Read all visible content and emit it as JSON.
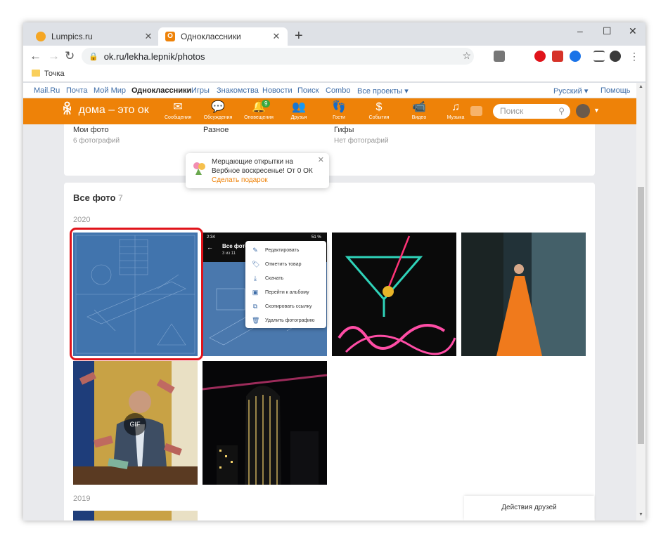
{
  "browser": {
    "tabs": [
      {
        "title": "Lumpics.ru",
        "active": false
      },
      {
        "title": "Одноклассники",
        "active": true
      }
    ],
    "new_tab": "+",
    "controls": {
      "minimize": "–",
      "maximize": "☐",
      "close": "✕"
    },
    "url": "ok.ru/lekha.lepnik/photos",
    "bookmark": "Точка"
  },
  "portal_links": [
    "Mail.Ru",
    "Почта",
    "Мой Мир",
    "Одноклассники",
    "Игры",
    "Знакомства",
    "Новости",
    "Поиск",
    "Combo",
    "Все проекты ▾"
  ],
  "portal_right": {
    "language": "Русский ▾",
    "help": "Помощь"
  },
  "ok_header": {
    "logo_text": "дома – это ок",
    "nav": [
      {
        "label": "Сообщения",
        "icon": "✉"
      },
      {
        "label": "Обсуждения",
        "icon": "💬"
      },
      {
        "label": "Оповещения",
        "icon": "🔔",
        "badge": "9"
      },
      {
        "label": "Друзья",
        "icon": "👥"
      },
      {
        "label": "Гости",
        "icon": "👣"
      },
      {
        "label": "События",
        "icon": "$"
      },
      {
        "label": "Видео",
        "icon": "📹"
      },
      {
        "label": "Музыка",
        "icon": "♫"
      }
    ],
    "search_placeholder": "Поиск"
  },
  "albums": [
    {
      "name": "Мои фото",
      "count": "6 фотографий"
    },
    {
      "name": "Разное",
      "count": ""
    },
    {
      "name": "Гифы",
      "count": "Нет фотографий"
    }
  ],
  "promo": {
    "text": "Мерцающие открытки на Вербное воскресенье! От 0 ОК",
    "link": "Сделать подарок"
  },
  "all_photos": {
    "title": "Все фото",
    "count": "7"
  },
  "years": [
    "2020",
    "2019"
  ],
  "gif_label": "GIF",
  "phone_shot": {
    "time": "2:34",
    "battery": "51 %",
    "title": "Все фото",
    "subtitle": "3 из 11"
  },
  "context_menu": [
    {
      "label": "Редактировать",
      "icon": "✎"
    },
    {
      "label": "Отметить товар",
      "icon": "🏷"
    },
    {
      "label": "Скачать",
      "icon": "⤓"
    },
    {
      "label": "Перейти к альбому",
      "icon": "▣"
    },
    {
      "label": "Скопировать ссылку",
      "icon": "⧉"
    },
    {
      "label": "Удалить фотографию",
      "icon": "🗑"
    }
  ],
  "friends_actions": "Действия друзей"
}
